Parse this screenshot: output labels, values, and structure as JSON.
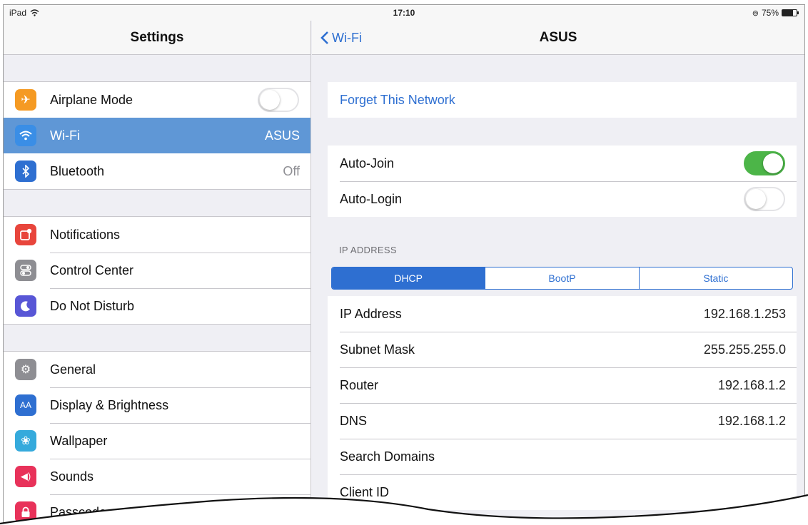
{
  "status": {
    "device": "iPad",
    "time": "17:10",
    "battery": "75%",
    "battery_level": 0.75
  },
  "left": {
    "title": "Settings",
    "group1": [
      {
        "label": "Airplane Mode",
        "icon": "airplane-icon",
        "color": "#f59a23",
        "toggle": false
      },
      {
        "label": "Wi-Fi",
        "icon": "wifi-icon",
        "color": "#3a8ee6",
        "value": "ASUS",
        "selected": true
      },
      {
        "label": "Bluetooth",
        "icon": "bluetooth-icon",
        "color": "#2e6fd1",
        "value": "Off"
      }
    ],
    "group2": [
      {
        "label": "Notifications",
        "icon": "notifications-icon",
        "color": "#e8453c"
      },
      {
        "label": "Control Center",
        "icon": "control-center-icon",
        "color": "#8e8e93"
      },
      {
        "label": "Do Not Disturb",
        "icon": "moon-icon",
        "color": "#5856d6"
      }
    ],
    "group3": [
      {
        "label": "General",
        "icon": "gear-icon",
        "color": "#8e8e93"
      },
      {
        "label": "Display & Brightness",
        "icon": "text-size-icon",
        "color": "#2e6fd1"
      },
      {
        "label": "Wallpaper",
        "icon": "wallpaper-icon",
        "color": "#35aadc"
      },
      {
        "label": "Sounds",
        "icon": "speaker-icon",
        "color": "#e8325a"
      },
      {
        "label": "Passcode",
        "icon": "lock-icon",
        "color": "#e8325a"
      }
    ]
  },
  "right": {
    "back_label": "Wi-Fi",
    "title": "ASUS",
    "forget_label": "Forget This Network",
    "auto_join": {
      "label": "Auto-Join",
      "on": true
    },
    "auto_login": {
      "label": "Auto-Login",
      "on": false
    },
    "ip_section_header": "IP ADDRESS",
    "ip_modes": [
      "DHCP",
      "BootP",
      "Static"
    ],
    "ip_mode_selected": "DHCP",
    "fields": [
      {
        "label": "IP Address",
        "value": "192.168.1.253"
      },
      {
        "label": "Subnet Mask",
        "value": "255.255.255.0"
      },
      {
        "label": "Router",
        "value": "192.168.1.2"
      },
      {
        "label": "DNS",
        "value": "192.168.1.2"
      },
      {
        "label": "Search Domains",
        "value": ""
      },
      {
        "label": "Client ID",
        "value": ""
      }
    ]
  }
}
